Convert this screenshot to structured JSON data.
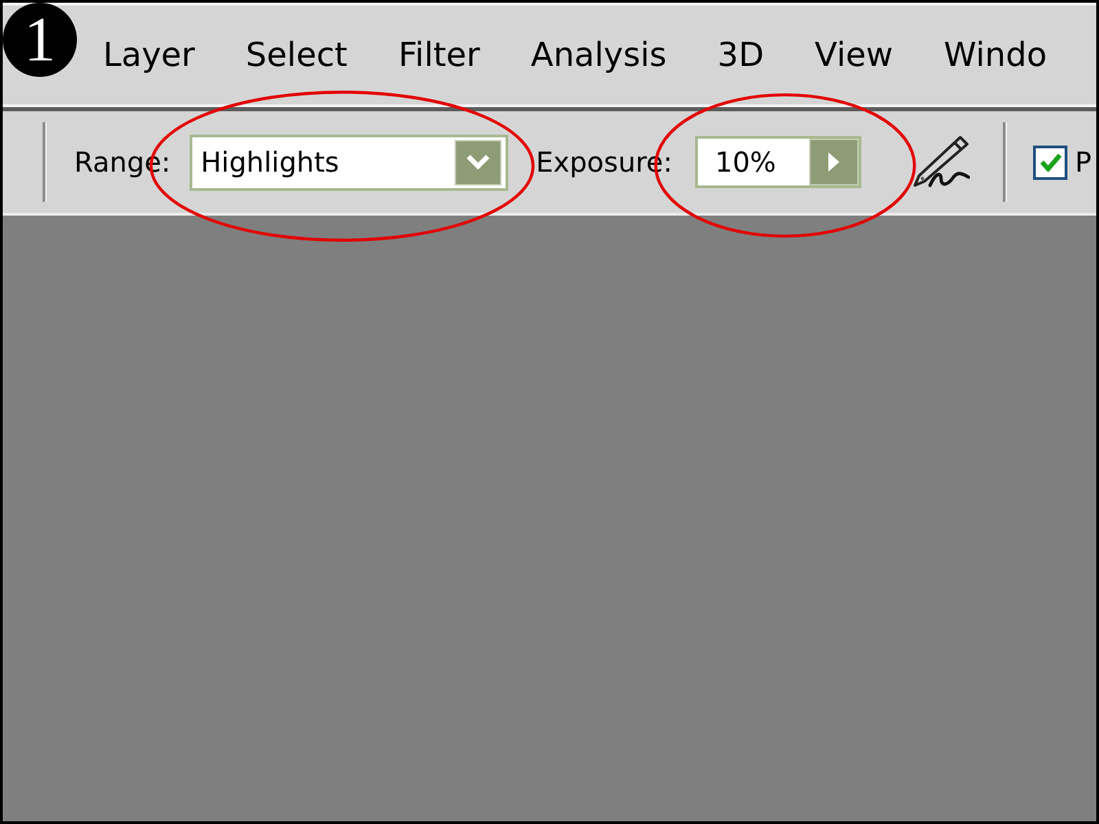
{
  "step_badge": "1",
  "menu": [
    {
      "label": "Layer"
    },
    {
      "label": "Select"
    },
    {
      "label": "Filter"
    },
    {
      "label": "Analysis"
    },
    {
      "label": "3D"
    },
    {
      "label": "View"
    },
    {
      "label": "Windo"
    }
  ],
  "options_bar": {
    "range": {
      "label": "Range:",
      "value": "Highlights",
      "circled": true
    },
    "exposure": {
      "label": "Exposure:",
      "value": "10%",
      "circled": true
    },
    "checkbox": {
      "label": "P",
      "checked": true
    }
  }
}
